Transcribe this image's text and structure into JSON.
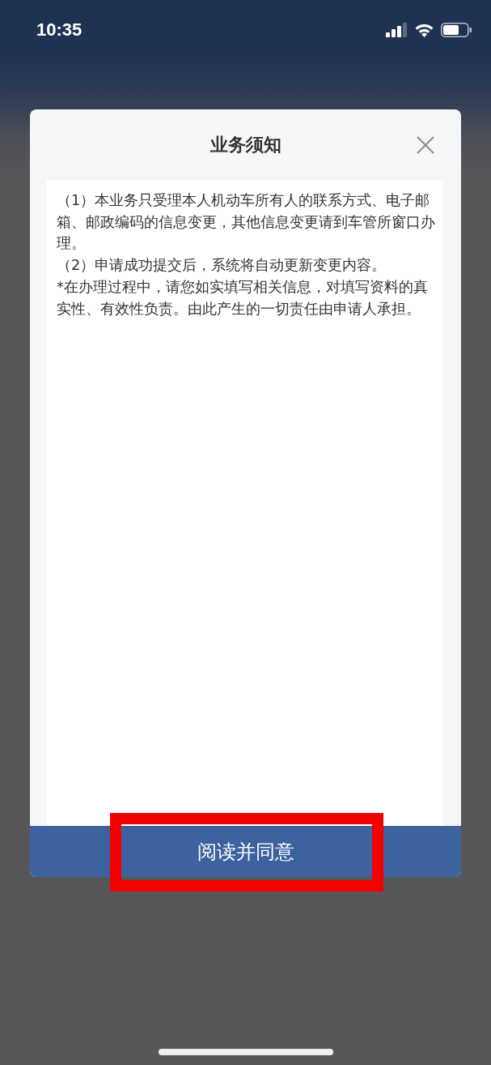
{
  "status_bar": {
    "time": "10:35"
  },
  "dialog": {
    "title": "业务须知",
    "notice": [
      "（1）本业务只受理本人机动车所有人的联系方式、电子邮箱、邮政编码的信息变更，其他信息变更请到车管所窗口办理。",
      "（2）申请成功提交后，系统将自动更新变更内容。",
      "*在办理过程中，请您如实填写相关信息，对填写资料的真实性、有效性负责。由此产生的一切责任由申请人承担。"
    ],
    "confirm_button": {
      "label": "阅读并同意",
      "highlighted": true
    }
  }
}
